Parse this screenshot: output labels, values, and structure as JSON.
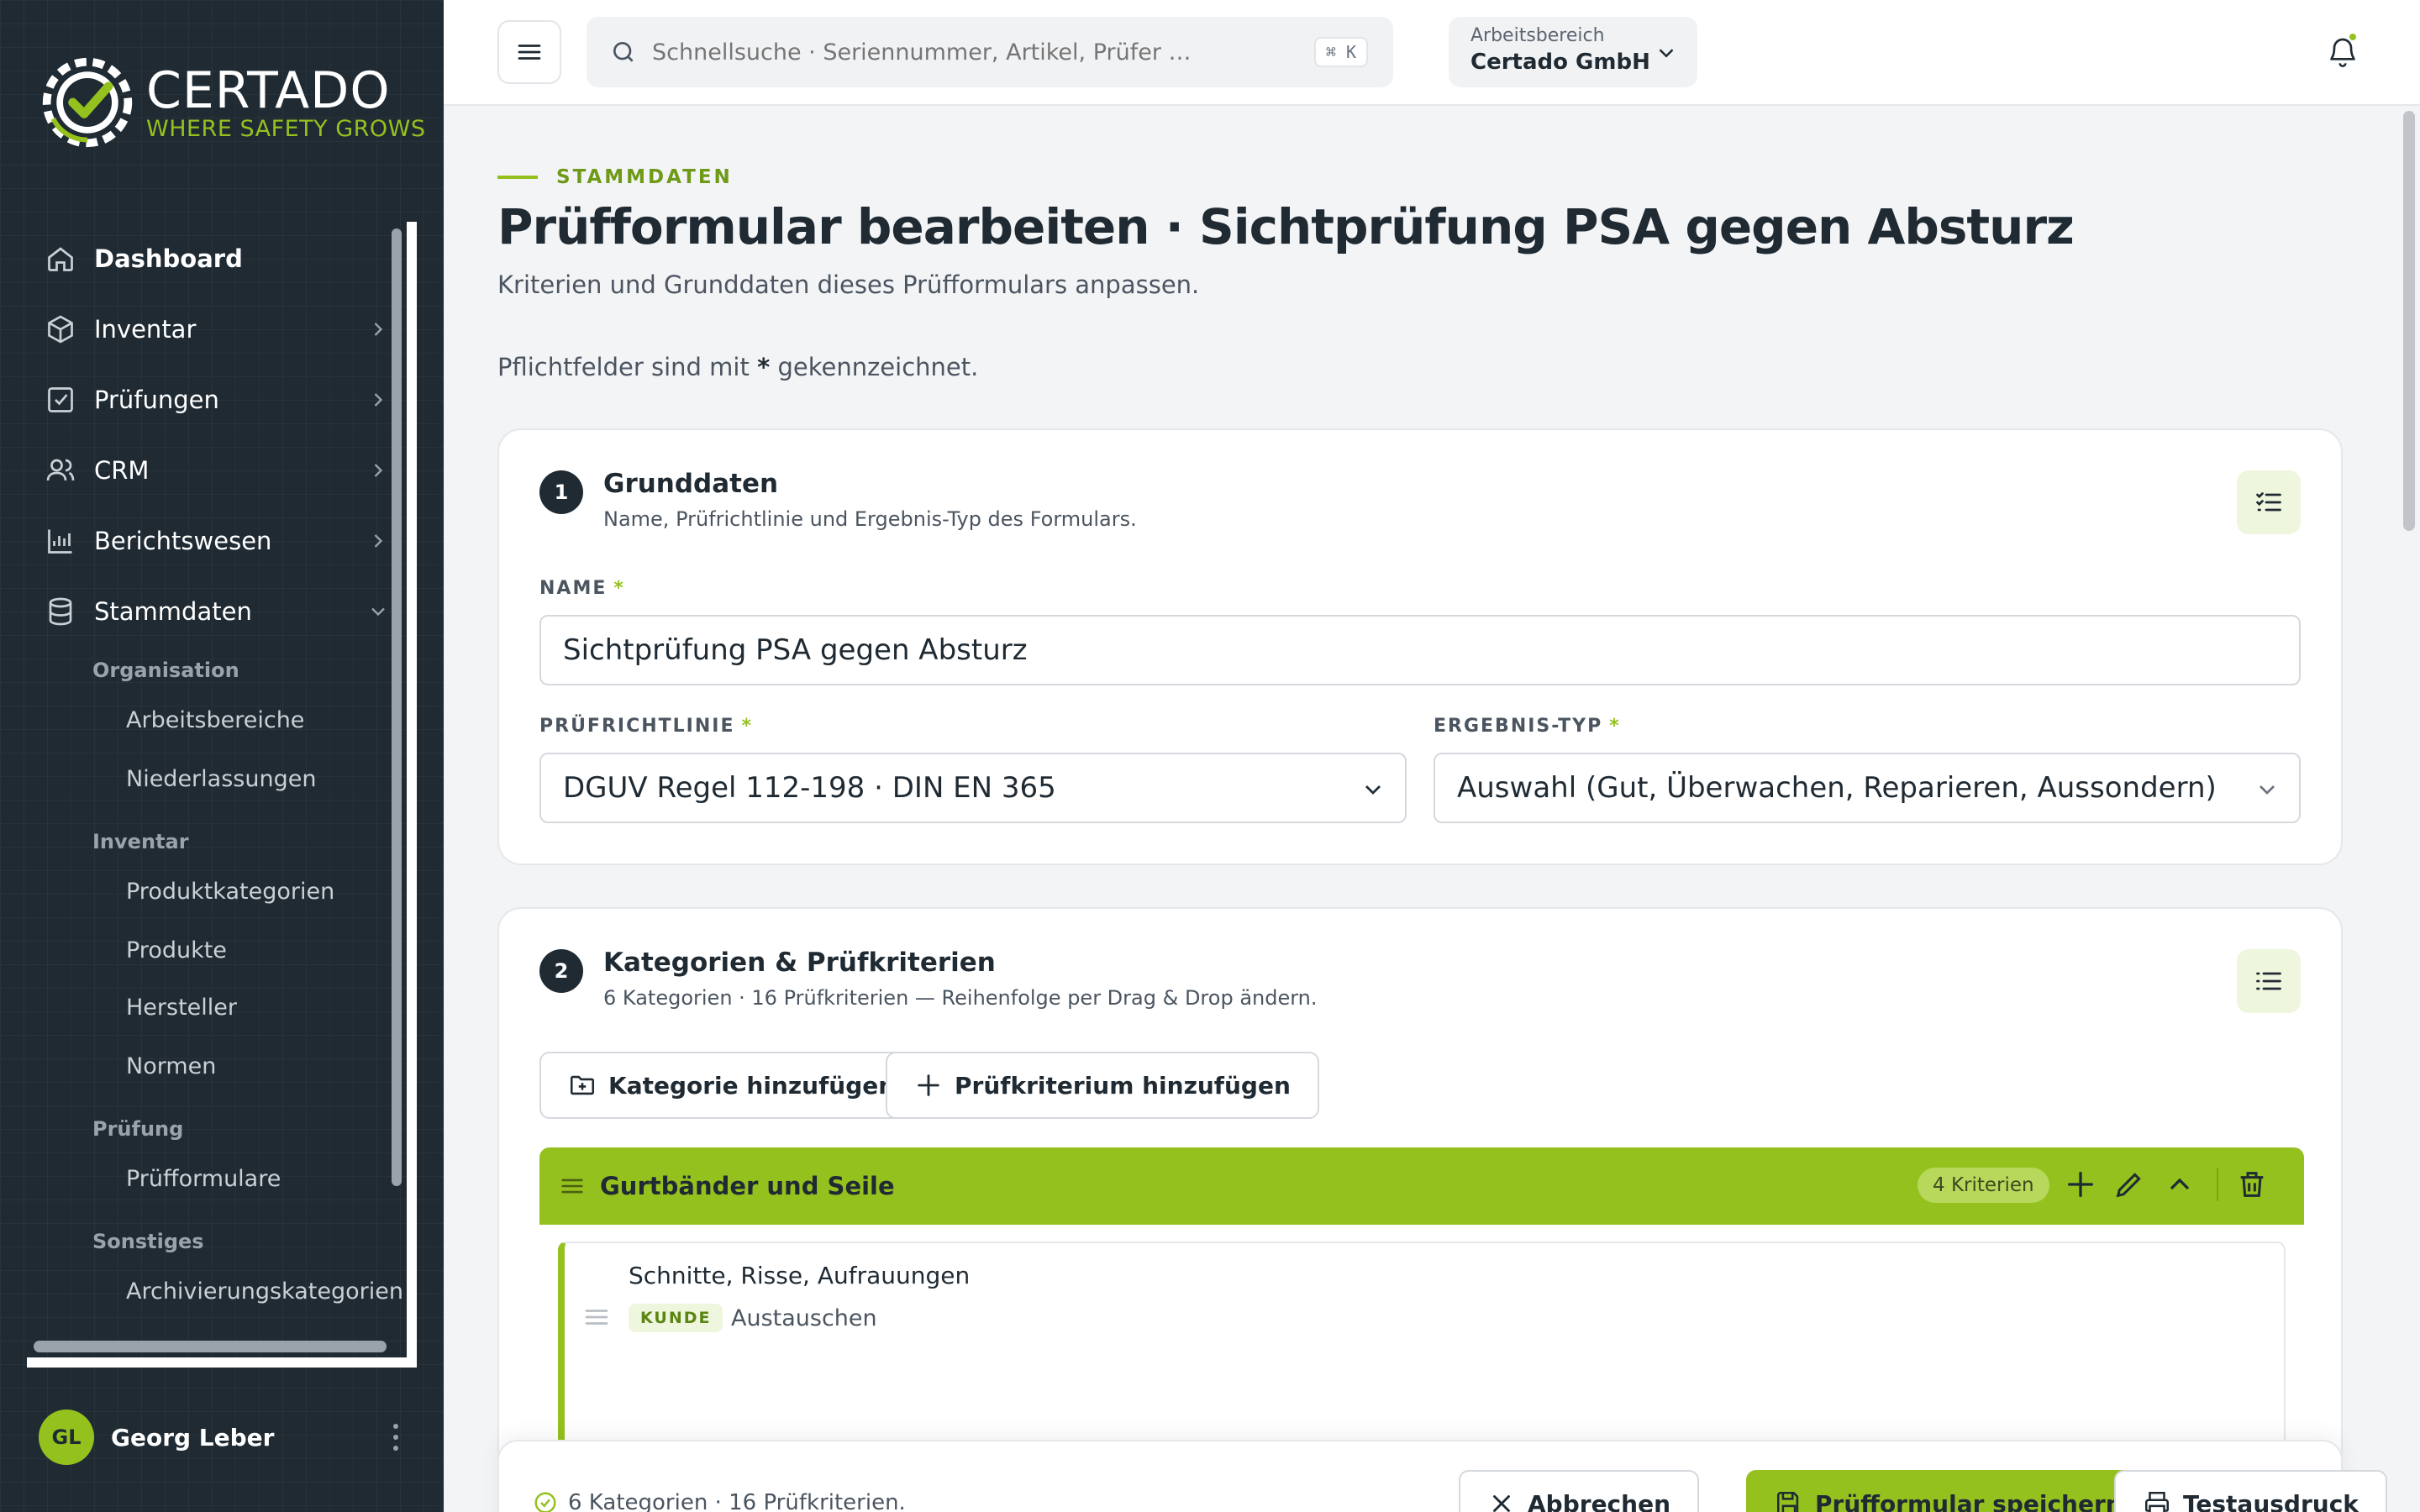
{
  "brand": {
    "name": "CERTADO",
    "tagline": "WHERE SAFETY GROWS",
    "accent_color": "#95c11f",
    "sidebar_color": "#1f2a33"
  },
  "sidebar": {
    "items": [
      {
        "label": "Dashboard",
        "icon": "home-icon"
      },
      {
        "label": "Inventar",
        "icon": "box-icon"
      },
      {
        "label": "Prüfungen",
        "icon": "checkbox-icon"
      },
      {
        "label": "CRM",
        "icon": "users-icon"
      },
      {
        "label": "Berichtswesen",
        "icon": "bar-chart-icon"
      },
      {
        "label": "Stammdaten",
        "icon": "database-icon"
      }
    ],
    "groups": [
      {
        "label": "Organisation",
        "items": [
          "Arbeitsbereiche",
          "Niederlassungen"
        ]
      },
      {
        "label": "Inventar",
        "items": [
          "Produktkategorien",
          "Produkte",
          "Hersteller",
          "Normen"
        ]
      },
      {
        "label": "Prüfung",
        "items": [
          "Prüfformulare"
        ]
      },
      {
        "label": "Sonstiges",
        "items": [
          "Archivierungskategorien"
        ]
      }
    ],
    "user": {
      "initials": "GL",
      "name": "Georg Leber"
    }
  },
  "topbar": {
    "search_placeholder": "Schnellsuche · Seriennummer, Artikel, Prüfer …",
    "search_shortcut": "⌘ K",
    "workspace_label": "Arbeitsbereich",
    "workspace_value": "Certado GmbH"
  },
  "page": {
    "eyebrow": "STAMMDATEN",
    "title": "Prüfformular bearbeiten · Sichtprüfung PSA gegen Absturz",
    "subtitle": "Kriterien und Grunddaten dieses Prüfformulars anpassen.",
    "required_note_pre": "Pflichtfelder sind mit",
    "required_note_star": "*",
    "required_note_post": "gekennzeichnet."
  },
  "grunddaten": {
    "step": "1",
    "title": "Grunddaten",
    "subtitle": "Name, Prüfrichtlinie und Ergebnis-Typ des Formulars.",
    "name_label": "NAME",
    "name_value": "Sichtprüfung PSA gegen Absturz",
    "richtlinie_label": "PRÜFRICHTLINIE",
    "richtlinie_value": "DGUV Regel 112-198 · DIN EN 365",
    "ergebnis_label": "ERGEBNIS-TYP",
    "ergebnis_value": "Auswahl (Gut, Überwachen, Reparieren, Aussondern)",
    "required_star": "*"
  },
  "kategorien": {
    "step": "2",
    "title": "Kategorien & Prüfkriterien",
    "subtitle": "6 Kategorien · 16 Prüfkriterien — Reihenfolge per Drag & Drop ändern.",
    "add_category_label": "Kategorie hinzufügen",
    "add_criterion_label": "Prüfkriterium hinzufügen",
    "categories": [
      {
        "name": "Gurtbänder und Seile",
        "count_label": "4 Kriterien",
        "criteria": [
          {
            "name": "Schnitte, Risse, Aufrauungen",
            "tag": "KUNDE",
            "value": "Austauschen"
          }
        ]
      }
    ]
  },
  "footer": {
    "summary": "6 Kategorien · 16 Prüfkriterien.",
    "cancel_label": "Abbrechen",
    "save_label": "Prüfformular speichern",
    "print_label": "Testausdruck"
  }
}
